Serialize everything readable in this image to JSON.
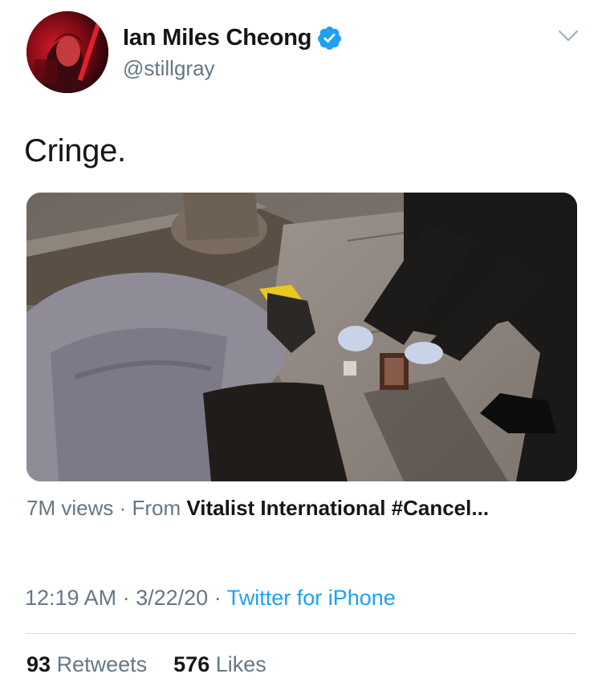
{
  "author": {
    "display_name": "Ian Miles Cheong",
    "handle": "@stillgray",
    "verified": true
  },
  "icons": {
    "verified": "verified-badge-icon",
    "more": "chevron-down-icon"
  },
  "tweet": {
    "text": "Cringe."
  },
  "media": {
    "views": "7M views",
    "separator": "·",
    "from_label": "From",
    "source": "Vitalist International #Cancel..."
  },
  "meta": {
    "time": "12:19 AM",
    "date": "3/22/20",
    "separator": "·",
    "client": "Twitter for iPhone"
  },
  "stats": {
    "retweets_count": "93",
    "retweets_label": "Retweets",
    "likes_count": "576",
    "likes_label": "Likes"
  },
  "colors": {
    "link_blue": "#1da1f2",
    "secondary_text": "#657786",
    "primary_text": "#14171a"
  }
}
